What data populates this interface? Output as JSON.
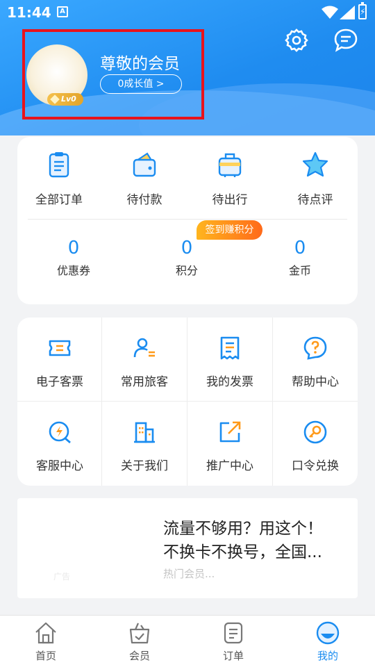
{
  "status_bar": {
    "time": "11:44",
    "notification_icon": "A"
  },
  "profile": {
    "title": "尊敬的会员",
    "growth_button": "0成长值 >",
    "level_badge": "Lv0"
  },
  "header_actions": {
    "settings": "gear-icon",
    "messages": "chat-bubble-icon"
  },
  "orders": {
    "items": [
      {
        "label": "全部订单",
        "icon": "clipboard-icon"
      },
      {
        "label": "待付款",
        "icon": "wallet-icon"
      },
      {
        "label": "待出行",
        "icon": "suitcase-icon"
      },
      {
        "label": "待点评",
        "icon": "star-icon"
      }
    ]
  },
  "stats": {
    "coupons": {
      "value": "0",
      "label": "优惠券"
    },
    "points": {
      "value": "0",
      "label": "积分"
    },
    "coins": {
      "value": "0",
      "label": "金币"
    },
    "checkin_badge": "签到赚积分"
  },
  "services": [
    {
      "label": "电子客票",
      "icon": "ticket-icon"
    },
    {
      "label": "常用旅客",
      "icon": "traveler-icon"
    },
    {
      "label": "我的发票",
      "icon": "invoice-icon"
    },
    {
      "label": "帮助中心",
      "icon": "help-icon"
    },
    {
      "label": "客服中心",
      "icon": "support-icon"
    },
    {
      "label": "关于我们",
      "icon": "building-icon"
    },
    {
      "label": "推广中心",
      "icon": "share-icon"
    },
    {
      "label": "口令兑换",
      "icon": "key-icon"
    }
  ],
  "ad": {
    "label": "广告",
    "line1": "流量不够用？用这个！",
    "line2": "不换卡不换号，全国...",
    "subtitle": "热门会员..."
  },
  "tabbar": {
    "items": [
      {
        "label": "首页",
        "icon": "home-icon"
      },
      {
        "label": "会员",
        "icon": "member-bag-icon"
      },
      {
        "label": "订单",
        "icon": "order-icon"
      },
      {
        "label": "我的",
        "icon": "profile-icon"
      }
    ],
    "active_index": 3
  },
  "colors": {
    "accent": "#1a8cf0",
    "badge_orange": "#ff6a1a",
    "highlight_box": "#e8131c"
  }
}
